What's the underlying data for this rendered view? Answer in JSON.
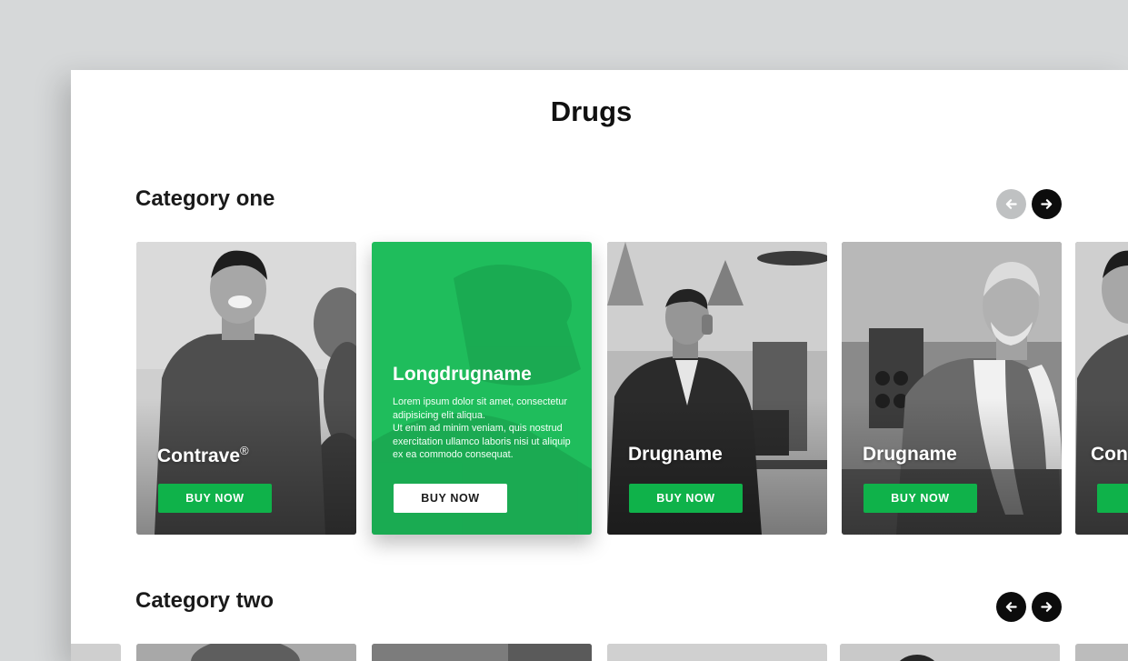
{
  "page": {
    "title": "Drugs"
  },
  "categories": [
    {
      "title": "Category one",
      "cards": [
        {
          "name": "Contrave",
          "mark": "®",
          "button": "BUY NOW"
        },
        {
          "name": "Longdrugname",
          "description_1": "Lorem ipsum dolor sit amet, consectetur adipisicing elit aliqua.",
          "description_2": "Ut enim ad minim veniam, quis nostrud exercitation ullamco laboris nisi ut aliquip ex ea commodo consequat.",
          "button": "BUY NOW"
        },
        {
          "name": "Drugname",
          "button": "BUY NOW"
        },
        {
          "name": "Drugname",
          "button": "BUY NOW"
        },
        {
          "name": "Con"
        }
      ]
    },
    {
      "title": "Category two"
    }
  ],
  "colors": {
    "accent": "#0fb24a",
    "highlight_card": "#1fbd5c",
    "arrow_active": "#0c0c0c",
    "arrow_disabled": "#bfc1c2"
  },
  "icons": {
    "prev": "arrow-left-icon",
    "next": "arrow-right-icon"
  }
}
